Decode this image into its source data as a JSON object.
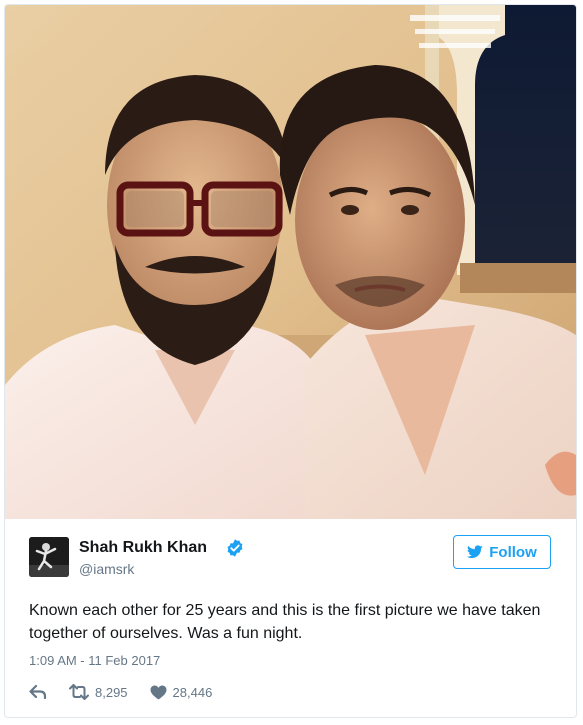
{
  "tweet": {
    "display_name": "Shah Rukh Khan",
    "handle": "@iamsrk",
    "verified": true,
    "follow_label": "Follow",
    "text": "Known each other for 25 years and this is the first picture we have taken together of ourselves. Was a fun night.",
    "timestamp": "1:09 AM - 11 Feb 2017",
    "retweets": "8,295",
    "likes": "28,446"
  },
  "icons": {
    "verified": "verified-badge-icon",
    "follow": "twitter-bird-icon",
    "reply": "reply-arrow-icon",
    "retweet": "retweet-icon",
    "like": "heart-icon"
  },
  "colors": {
    "accent": "#1da1f2",
    "text": "#14171a",
    "muted": "#657786",
    "border": "#e1e8ed"
  }
}
